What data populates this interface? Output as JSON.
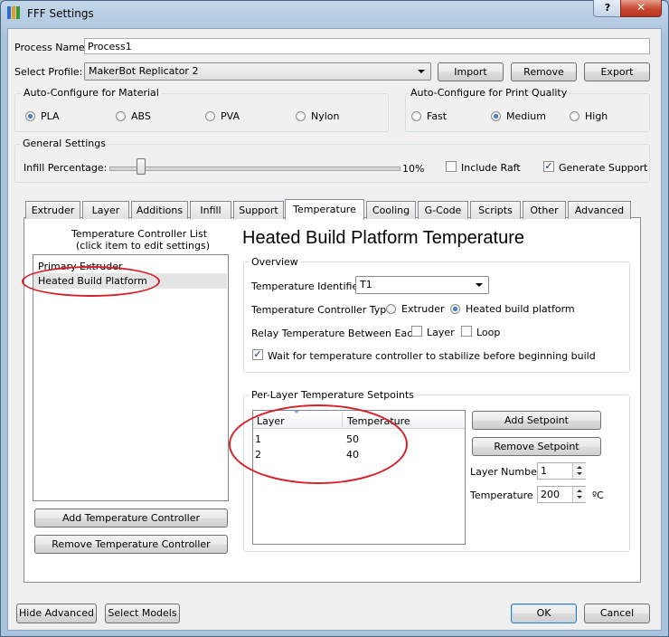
{
  "window": {
    "title": "FFF Settings",
    "help": "?",
    "close": "✕"
  },
  "process": {
    "label": "Process Name:",
    "value": "Process1"
  },
  "profile": {
    "label": "Select Profile:",
    "value": "MakerBot Replicator 2",
    "import": "Import",
    "remove": "Remove",
    "export": "Export"
  },
  "material": {
    "title": "Auto-Configure for Material",
    "options": [
      "PLA",
      "ABS",
      "PVA",
      "Nylon"
    ],
    "selected": "PLA"
  },
  "quality": {
    "title": "Auto-Configure for Print Quality",
    "options": [
      "Fast",
      "Medium",
      "High"
    ],
    "selected": "Medium"
  },
  "general": {
    "title": "General Settings",
    "infill_label": "Infill Percentage:",
    "infill_value": "10%",
    "infill_fraction": 0.1,
    "include_raft": "Include Raft",
    "include_raft_checked": false,
    "generate_support": "Generate Support",
    "generate_support_checked": true
  },
  "tabs": [
    "Extruder",
    "Layer",
    "Additions",
    "Infill",
    "Support",
    "Temperature",
    "Cooling",
    "G-Code",
    "Scripts",
    "Other",
    "Advanced"
  ],
  "active_tab": "Temperature",
  "controllers": {
    "heading": "Temperature Controller List",
    "subheading": "(click item to edit settings)",
    "items": [
      "Primary Extruder",
      "Heated Build Platform"
    ],
    "selected": "Heated Build Platform",
    "add": "Add Temperature Controller",
    "remove": "Remove Temperature Controller"
  },
  "detail": {
    "title": "Heated Build Platform Temperature",
    "overview": "Overview",
    "identifier_label": "Temperature Identifier",
    "identifier_value": "T1",
    "type_label": "Temperature Controller Type:",
    "type_extruder": "Extruder",
    "type_platform": "Heated build platform",
    "relay_label": "Relay Temperature Between Each:",
    "relay_layer": "Layer",
    "relay_loop": "Loop",
    "wait_label": "Wait for temperature controller to stabilize before beginning build"
  },
  "setpoints": {
    "title": "Per-Layer Temperature Setpoints",
    "columns": [
      "Layer",
      "Temperature"
    ],
    "rows": [
      [
        "1",
        "50"
      ],
      [
        "2",
        "40"
      ]
    ],
    "add": "Add Setpoint",
    "remove": "Remove Setpoint",
    "layer_number_label": "Layer Number",
    "layer_number_value": "1",
    "temperature_label": "Temperature",
    "temperature_value": "200",
    "temperature_unit": "ºC"
  },
  "footer": {
    "hide_advanced": "Hide Advanced",
    "select_models": "Select Models",
    "ok": "OK",
    "cancel": "Cancel"
  },
  "colors": {
    "annotation": "#d6202a",
    "selection": "#e5e5e5",
    "accent": "#1d4f8c"
  }
}
